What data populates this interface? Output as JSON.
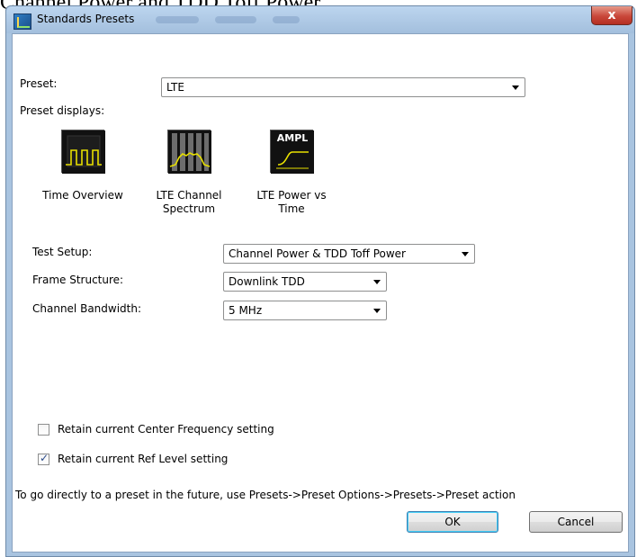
{
  "caption": "Channel Power and TDD Toff Power",
  "window": {
    "title": "Standards Presets",
    "close_glyph": "x"
  },
  "preset": {
    "label": "Preset:",
    "value": "LTE"
  },
  "preset_displays": {
    "label": "Preset displays:",
    "items": [
      {
        "icon": "time-overview-icon",
        "caption": "Time Overview"
      },
      {
        "icon": "lte-channel-spectrum-icon",
        "caption": "LTE Channel Spectrum"
      },
      {
        "icon": "lte-power-vs-time-icon",
        "caption": "LTE Power vs Time",
        "icon_text": "AMPL"
      }
    ]
  },
  "settings": {
    "test_setup": {
      "label": "Test Setup:",
      "value": "Channel Power & TDD Toff Power"
    },
    "frame_structure": {
      "label": "Frame Structure:",
      "value": "Downlink TDD"
    },
    "channel_bandwidth": {
      "label": "Channel Bandwidth:",
      "value": "5 MHz"
    }
  },
  "checkboxes": {
    "retain_center_frequency": {
      "label": "Retain current Center Frequency setting",
      "checked": false
    },
    "retain_ref_level": {
      "label": "Retain current Ref Level setting",
      "checked": true
    }
  },
  "hint": "To go directly to a preset in the future, use Presets->Preset Options->Presets->Preset action",
  "buttons": {
    "ok": "OK",
    "cancel": "Cancel"
  },
  "colors": {
    "trace_yellow": "#e8e000",
    "titlebar_blue": "#a9c4e0",
    "close_red": "#c9473a"
  }
}
